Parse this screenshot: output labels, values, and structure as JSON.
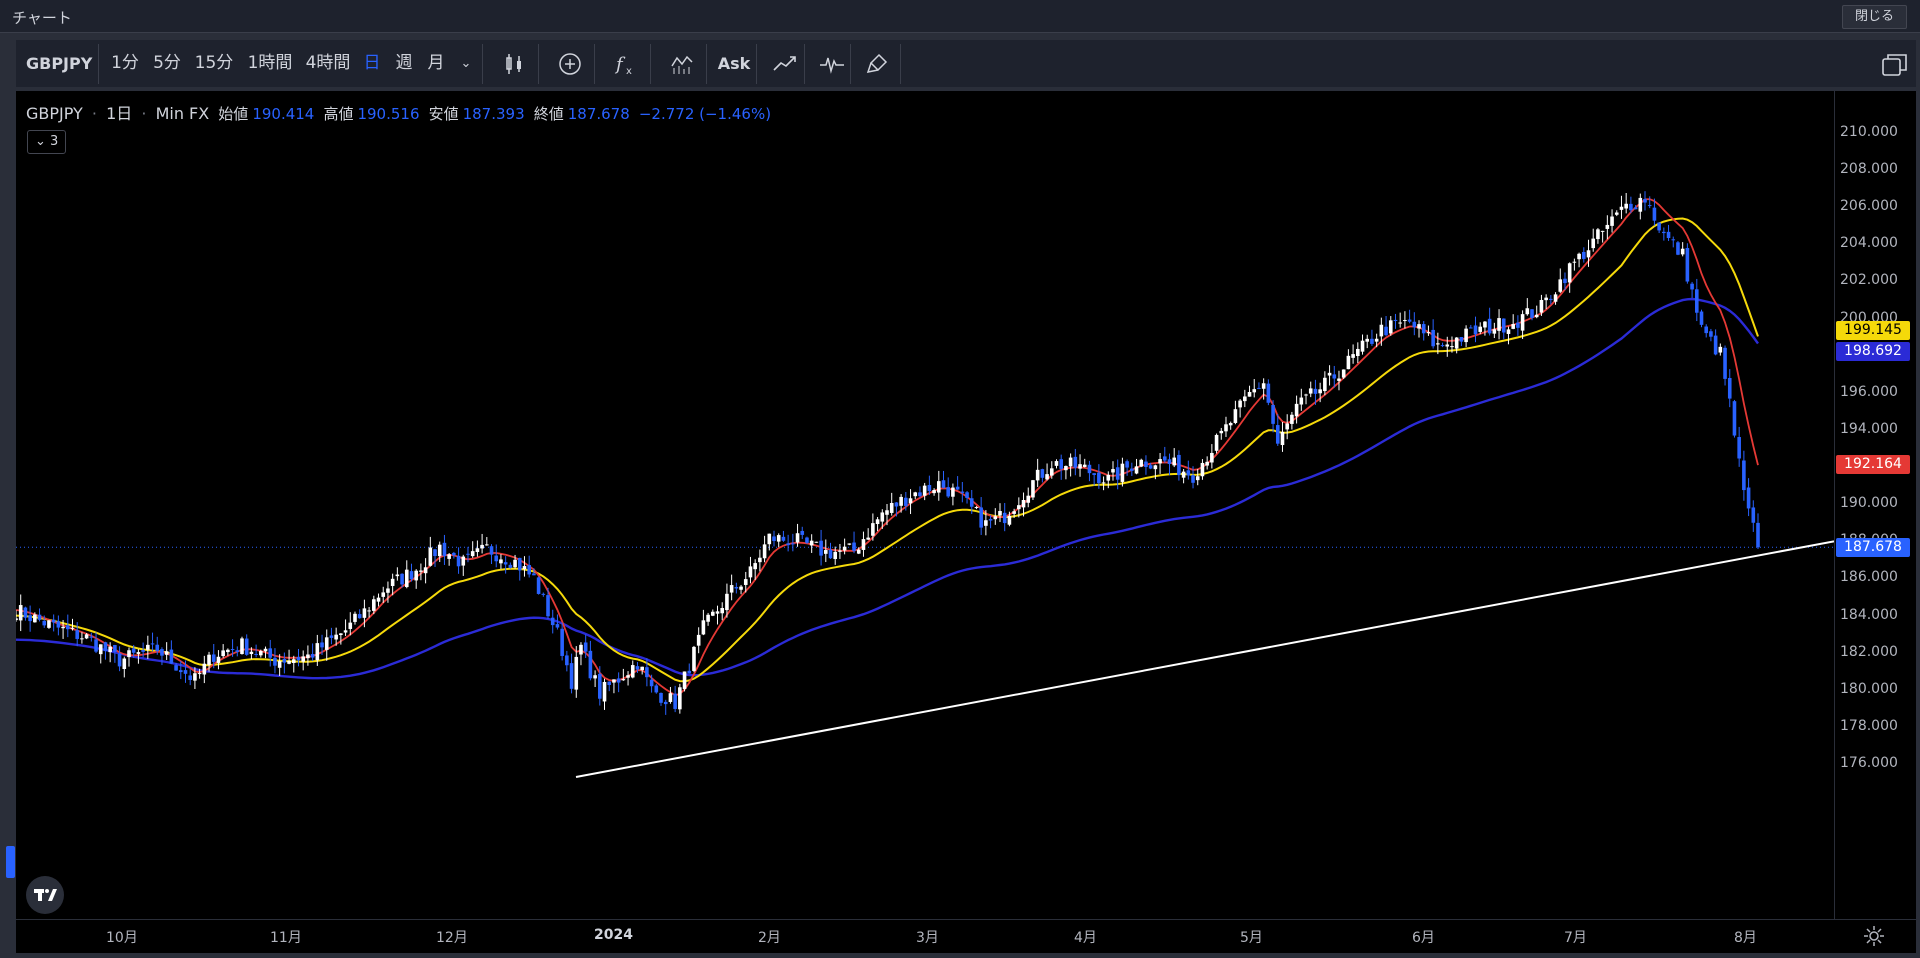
{
  "window": {
    "title": "チャート",
    "close_label": "閉じる"
  },
  "toolbar": {
    "symbol": "GBPJPY",
    "intervals": [
      "1分",
      "5分",
      "15分",
      "1時間",
      "4時間",
      "日",
      "週",
      "月"
    ],
    "active_interval": "日",
    "ask_label": "Ask",
    "icons": [
      "candle-style-icon",
      "add-indicator-icon",
      "formula-icon",
      "bar-compare-icon",
      "ask-label",
      "line-draw-icon",
      "pulse-icon",
      "brush-icon",
      "layout-icon"
    ]
  },
  "legend": {
    "symbol": "GBPJPY",
    "interval": "1日",
    "source": "Min FX",
    "open_label": "始値",
    "open": "190.414",
    "high_label": "高値",
    "high": "190.516",
    "low_label": "安値",
    "low": "187.393",
    "close_label": "終値",
    "close": "187.678",
    "change": "−2.772 (−1.46%)",
    "collapsed_count": "3"
  },
  "price_axis": {
    "labels": [
      "210.000",
      "208.000",
      "206.000",
      "204.000",
      "202.000",
      "200.000",
      "198.000",
      "196.000",
      "194.000",
      "192.000",
      "190.000",
      "188.000",
      "186.000",
      "184.000",
      "182.000",
      "180.000",
      "178.000",
      "176.000"
    ],
    "badges": [
      {
        "value": "199.145",
        "bg": "#f5d90a",
        "fg": "#000000"
      },
      {
        "value": "198.692",
        "bg": "#2b2bd6",
        "fg": "#ffffff"
      },
      {
        "value": "192.164",
        "bg": "#e53935",
        "fg": "#ffffff"
      },
      {
        "value": "187.678",
        "bg": "#2962ff",
        "fg": "#ffffff"
      }
    ]
  },
  "time_axis": {
    "labels": [
      "10月",
      "11月",
      "12月",
      "2024",
      "2月",
      "3月",
      "4月",
      "5月",
      "6月",
      "7月",
      "8月"
    ]
  },
  "chart_data": {
    "type": "candlestick",
    "symbol": "GBPJPY",
    "y_range": [
      175.5,
      211.0
    ],
    "colors": {
      "up": "#ffffff",
      "down": "#2962ff",
      "ma_fast": "#e53935",
      "ma_mid": "#f5d90a",
      "ma_slow": "#2b2bd6",
      "trendline": "#ffffff"
    },
    "current_price": 187.678,
    "ma_fast_last": 192.164,
    "ma_mid_last": 199.145,
    "ma_slow_last": 198.692,
    "close_path": [
      [
        0,
        184.3
      ],
      [
        8,
        183.4
      ],
      [
        15,
        182.8
      ],
      [
        22,
        181.6
      ],
      [
        30,
        182.2
      ],
      [
        38,
        180.5
      ],
      [
        42,
        181.9
      ],
      [
        48,
        182.4
      ],
      [
        55,
        181.6
      ],
      [
        62,
        181.8
      ],
      [
        70,
        183.2
      ],
      [
        74,
        184.2
      ],
      [
        78,
        185.4
      ],
      [
        85,
        186.5
      ],
      [
        90,
        187.7
      ],
      [
        95,
        186.8
      ],
      [
        100,
        187.6
      ],
      [
        106,
        186.9
      ],
      [
        110,
        186.0
      ],
      [
        115,
        183.0
      ],
      [
        118,
        180.5
      ],
      [
        120,
        182.3
      ],
      [
        124,
        179.8
      ],
      [
        128,
        180.6
      ],
      [
        132,
        181.5
      ],
      [
        135,
        180.0
      ],
      [
        140,
        179.3
      ],
      [
        146,
        183.3
      ],
      [
        152,
        185.3
      ],
      [
        156,
        186.3
      ],
      [
        160,
        188.2
      ],
      [
        166,
        188.0
      ],
      [
        172,
        187.4
      ],
      [
        178,
        187.5
      ],
      [
        184,
        189.5
      ],
      [
        190,
        190.5
      ],
      [
        196,
        191.1
      ],
      [
        200,
        190.5
      ],
      [
        206,
        188.9
      ],
      [
        210,
        189.4
      ],
      [
        216,
        191.2
      ],
      [
        220,
        192.2
      ],
      [
        226,
        192.0
      ],
      [
        232,
        191.3
      ],
      [
        238,
        192.3
      ],
      [
        244,
        192.3
      ],
      [
        250,
        191.6
      ],
      [
        256,
        193.7
      ],
      [
        262,
        195.9
      ],
      [
        265,
        196.6
      ],
      [
        268,
        193.2
      ],
      [
        272,
        195.2
      ],
      [
        278,
        196.4
      ],
      [
        284,
        197.9
      ],
      [
        290,
        199.4
      ],
      [
        296,
        199.8
      ],
      [
        302,
        198.5
      ],
      [
        306,
        198.9
      ],
      [
        312,
        199.5
      ],
      [
        318,
        199.8
      ],
      [
        324,
        200.6
      ],
      [
        330,
        202.7
      ],
      [
        336,
        204.4
      ],
      [
        342,
        206.1
      ],
      [
        346,
        206.5
      ],
      [
        350,
        204.5
      ],
      [
        354,
        203.4
      ],
      [
        358,
        199.4
      ],
      [
        362,
        198.1
      ],
      [
        364,
        195.4
      ],
      [
        367,
        190.5
      ],
      [
        370,
        187.7
      ]
    ],
    "trendline": {
      "from": [
        0,
        171.2
      ],
      "to": [
        370,
        188.0
      ]
    }
  }
}
